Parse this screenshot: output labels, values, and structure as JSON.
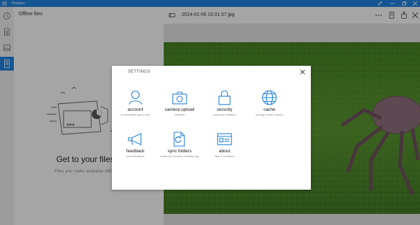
{
  "app": {
    "title": "Dropbox"
  },
  "colors": {
    "accent": "#1f7fd8",
    "overlay": "rgba(0,0,0,0.32)"
  },
  "titlebar": {
    "controls": [
      "expand-icon",
      "minimize-icon",
      "maximize-icon",
      "close-icon"
    ]
  },
  "rail": {
    "items": [
      "recents-icon",
      "files-icon",
      "photos-icon",
      "offline-files-icon"
    ],
    "active": "offline-files-icon"
  },
  "pane": {
    "title": "Offline files",
    "empty_title": "Get to your files o",
    "empty_subtitle": "Files you make available offline wil"
  },
  "viewer": {
    "file_name": "2014-01-06 10.01.57.jpg",
    "toolbar_icons": [
      "more-icon",
      "device-icon",
      "share-icon",
      "close-icon"
    ]
  },
  "dialog": {
    "title": "SETTINGS",
    "tiles": [
      {
        "label": "account",
        "sub": "en.sbma@dropbox.com",
        "icon": "person-icon"
      },
      {
        "label": "camera upload",
        "sub": "disabled",
        "icon": "camera-icon"
      },
      {
        "label": "security",
        "sub": "passcode disabled",
        "icon": "lock-icon"
      },
      {
        "label": "cache",
        "sub": "manage cache system",
        "icon": "globe-icon"
      },
      {
        "label": "feedback",
        "sub": "send feedback",
        "icon": "megaphone-icon"
      },
      {
        "label": "sync folders",
        "sub": "Install the Dropbox desktop app",
        "icon": "sync-folder-icon"
      },
      {
        "label": "about",
        "sub": "help & feedback",
        "icon": "about-icon"
      }
    ]
  }
}
